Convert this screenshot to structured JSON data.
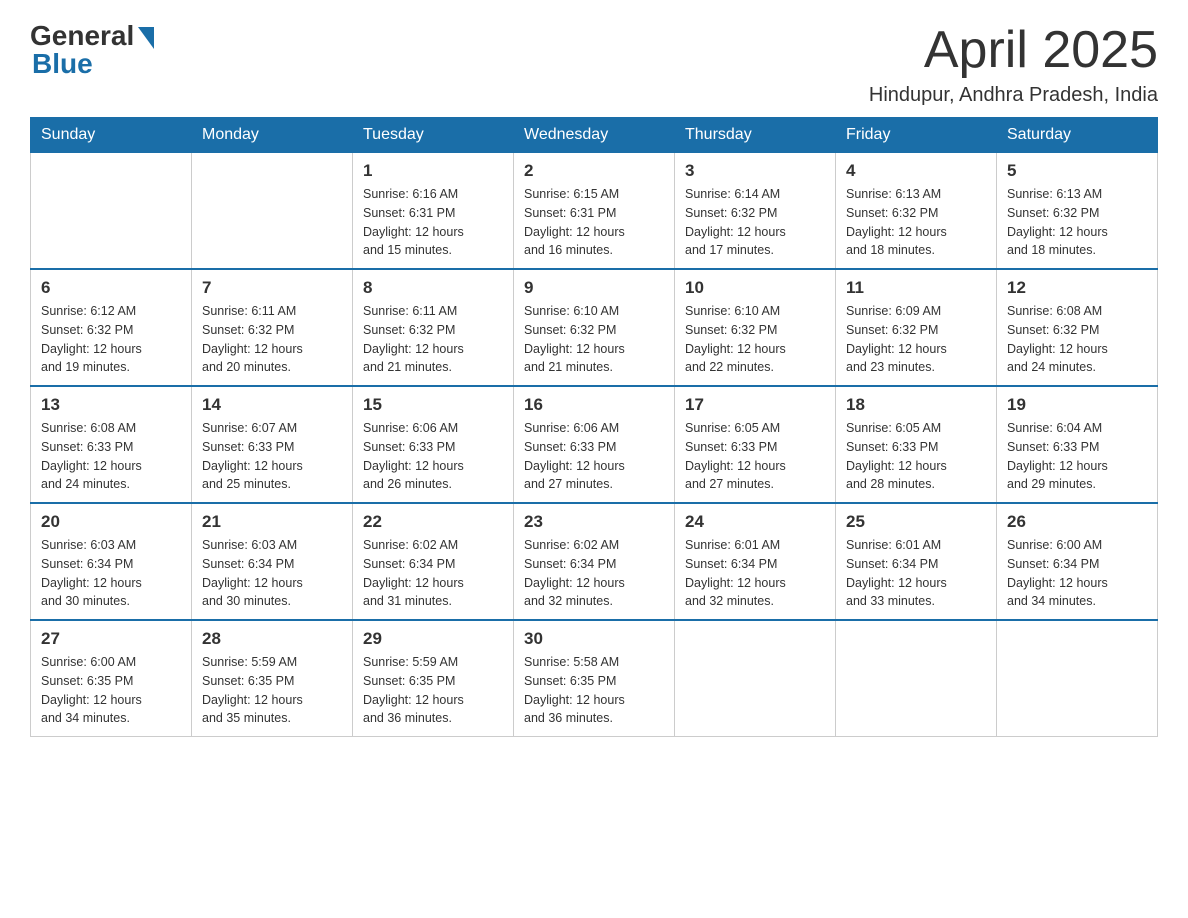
{
  "header": {
    "logo_general": "General",
    "logo_blue": "Blue",
    "month_year": "April 2025",
    "location": "Hindupur, Andhra Pradesh, India"
  },
  "days_of_week": [
    "Sunday",
    "Monday",
    "Tuesday",
    "Wednesday",
    "Thursday",
    "Friday",
    "Saturday"
  ],
  "weeks": [
    [
      {
        "day": "",
        "info": ""
      },
      {
        "day": "",
        "info": ""
      },
      {
        "day": "1",
        "info": "Sunrise: 6:16 AM\nSunset: 6:31 PM\nDaylight: 12 hours\nand 15 minutes."
      },
      {
        "day": "2",
        "info": "Sunrise: 6:15 AM\nSunset: 6:31 PM\nDaylight: 12 hours\nand 16 minutes."
      },
      {
        "day": "3",
        "info": "Sunrise: 6:14 AM\nSunset: 6:32 PM\nDaylight: 12 hours\nand 17 minutes."
      },
      {
        "day": "4",
        "info": "Sunrise: 6:13 AM\nSunset: 6:32 PM\nDaylight: 12 hours\nand 18 minutes."
      },
      {
        "day": "5",
        "info": "Sunrise: 6:13 AM\nSunset: 6:32 PM\nDaylight: 12 hours\nand 18 minutes."
      }
    ],
    [
      {
        "day": "6",
        "info": "Sunrise: 6:12 AM\nSunset: 6:32 PM\nDaylight: 12 hours\nand 19 minutes."
      },
      {
        "day": "7",
        "info": "Sunrise: 6:11 AM\nSunset: 6:32 PM\nDaylight: 12 hours\nand 20 minutes."
      },
      {
        "day": "8",
        "info": "Sunrise: 6:11 AM\nSunset: 6:32 PM\nDaylight: 12 hours\nand 21 minutes."
      },
      {
        "day": "9",
        "info": "Sunrise: 6:10 AM\nSunset: 6:32 PM\nDaylight: 12 hours\nand 21 minutes."
      },
      {
        "day": "10",
        "info": "Sunrise: 6:10 AM\nSunset: 6:32 PM\nDaylight: 12 hours\nand 22 minutes."
      },
      {
        "day": "11",
        "info": "Sunrise: 6:09 AM\nSunset: 6:32 PM\nDaylight: 12 hours\nand 23 minutes."
      },
      {
        "day": "12",
        "info": "Sunrise: 6:08 AM\nSunset: 6:32 PM\nDaylight: 12 hours\nand 24 minutes."
      }
    ],
    [
      {
        "day": "13",
        "info": "Sunrise: 6:08 AM\nSunset: 6:33 PM\nDaylight: 12 hours\nand 24 minutes."
      },
      {
        "day": "14",
        "info": "Sunrise: 6:07 AM\nSunset: 6:33 PM\nDaylight: 12 hours\nand 25 minutes."
      },
      {
        "day": "15",
        "info": "Sunrise: 6:06 AM\nSunset: 6:33 PM\nDaylight: 12 hours\nand 26 minutes."
      },
      {
        "day": "16",
        "info": "Sunrise: 6:06 AM\nSunset: 6:33 PM\nDaylight: 12 hours\nand 27 minutes."
      },
      {
        "day": "17",
        "info": "Sunrise: 6:05 AM\nSunset: 6:33 PM\nDaylight: 12 hours\nand 27 minutes."
      },
      {
        "day": "18",
        "info": "Sunrise: 6:05 AM\nSunset: 6:33 PM\nDaylight: 12 hours\nand 28 minutes."
      },
      {
        "day": "19",
        "info": "Sunrise: 6:04 AM\nSunset: 6:33 PM\nDaylight: 12 hours\nand 29 minutes."
      }
    ],
    [
      {
        "day": "20",
        "info": "Sunrise: 6:03 AM\nSunset: 6:34 PM\nDaylight: 12 hours\nand 30 minutes."
      },
      {
        "day": "21",
        "info": "Sunrise: 6:03 AM\nSunset: 6:34 PM\nDaylight: 12 hours\nand 30 minutes."
      },
      {
        "day": "22",
        "info": "Sunrise: 6:02 AM\nSunset: 6:34 PM\nDaylight: 12 hours\nand 31 minutes."
      },
      {
        "day": "23",
        "info": "Sunrise: 6:02 AM\nSunset: 6:34 PM\nDaylight: 12 hours\nand 32 minutes."
      },
      {
        "day": "24",
        "info": "Sunrise: 6:01 AM\nSunset: 6:34 PM\nDaylight: 12 hours\nand 32 minutes."
      },
      {
        "day": "25",
        "info": "Sunrise: 6:01 AM\nSunset: 6:34 PM\nDaylight: 12 hours\nand 33 minutes."
      },
      {
        "day": "26",
        "info": "Sunrise: 6:00 AM\nSunset: 6:34 PM\nDaylight: 12 hours\nand 34 minutes."
      }
    ],
    [
      {
        "day": "27",
        "info": "Sunrise: 6:00 AM\nSunset: 6:35 PM\nDaylight: 12 hours\nand 34 minutes."
      },
      {
        "day": "28",
        "info": "Sunrise: 5:59 AM\nSunset: 6:35 PM\nDaylight: 12 hours\nand 35 minutes."
      },
      {
        "day": "29",
        "info": "Sunrise: 5:59 AM\nSunset: 6:35 PM\nDaylight: 12 hours\nand 36 minutes."
      },
      {
        "day": "30",
        "info": "Sunrise: 5:58 AM\nSunset: 6:35 PM\nDaylight: 12 hours\nand 36 minutes."
      },
      {
        "day": "",
        "info": ""
      },
      {
        "day": "",
        "info": ""
      },
      {
        "day": "",
        "info": ""
      }
    ]
  ]
}
